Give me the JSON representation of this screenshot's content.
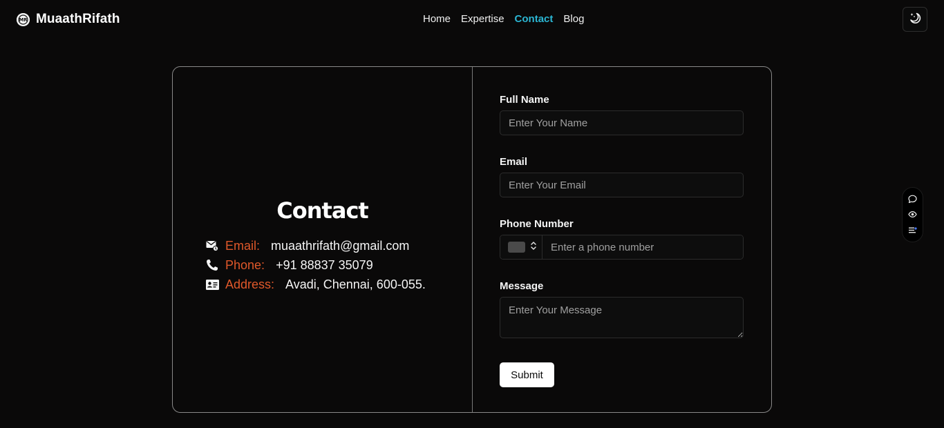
{
  "brand": {
    "name": "MuaathRifath",
    "logo_icon": "mr-logo-icon"
  },
  "nav": {
    "items": [
      {
        "label": "Home",
        "active": false
      },
      {
        "label": "Expertise",
        "active": false
      },
      {
        "label": "Contact",
        "active": true
      },
      {
        "label": "Blog",
        "active": false
      }
    ]
  },
  "theme_toggle": {
    "icon": "moon-stars-icon"
  },
  "contact": {
    "title": "Contact",
    "info": [
      {
        "icon": "mail-icon",
        "label": "Email:",
        "value": "muaathrifath@gmail.com"
      },
      {
        "icon": "phone-icon",
        "label": "Phone:",
        "value": "+91 88837 35079"
      },
      {
        "icon": "id-card-icon",
        "label": "Address:",
        "value": "Avadi, Chennai, 600-055."
      }
    ]
  },
  "form": {
    "full_name": {
      "label": "Full Name",
      "placeholder": "Enter Your Name",
      "value": ""
    },
    "email": {
      "label": "Email",
      "placeholder": "Enter Your Email",
      "value": ""
    },
    "phone": {
      "label": "Phone Number",
      "placeholder": "Enter a phone number",
      "value": ""
    },
    "message": {
      "label": "Message",
      "placeholder": "Enter Your Message",
      "value": ""
    },
    "submit_label": "Submit"
  },
  "side_widget": {
    "icons": [
      "chat-bubble-icon",
      "eye-icon",
      "list-settings-icon"
    ]
  },
  "colors": {
    "background": "#0a0909",
    "accent": "#2bb6d3",
    "label_accent": "#e0582a"
  }
}
